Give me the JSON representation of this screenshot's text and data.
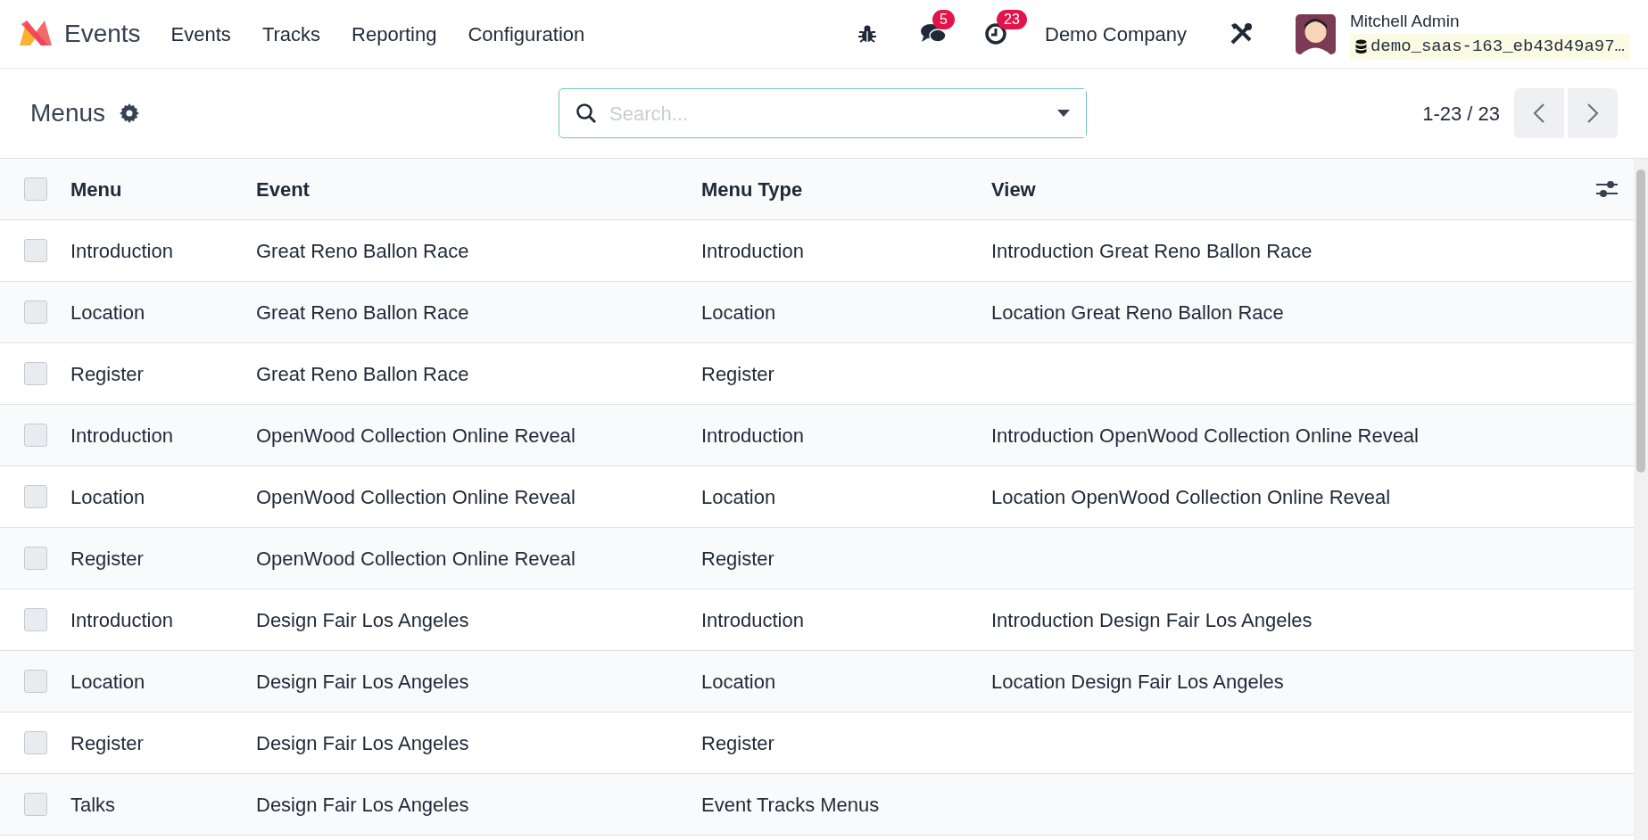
{
  "navbar": {
    "app_name": "Events",
    "menu": [
      "Events",
      "Tracks",
      "Reporting",
      "Configuration"
    ],
    "messages_badge": "5",
    "activities_badge": "23",
    "company": "Demo Company",
    "user": {
      "name": "Mitchell Admin",
      "database": "demo_saas-163_eb43d49a97…"
    }
  },
  "control_panel": {
    "title": "Menus",
    "search": {
      "placeholder": "Search..."
    },
    "pager": "1-23 / 23"
  },
  "table": {
    "columns": [
      "Menu",
      "Event",
      "Menu Type",
      "View"
    ],
    "all_checked": false,
    "rows": [
      {
        "checked": false,
        "cells": [
          "Introduction",
          "Great Reno Ballon Race",
          "Introduction",
          "Introduction Great Reno Ballon Race"
        ]
      },
      {
        "checked": false,
        "cells": [
          "Location",
          "Great Reno Ballon Race",
          "Location",
          "Location Great Reno Ballon Race"
        ]
      },
      {
        "checked": false,
        "cells": [
          "Register",
          "Great Reno Ballon Race",
          "Register",
          ""
        ]
      },
      {
        "checked": false,
        "cells": [
          "Introduction",
          "OpenWood Collection Online Reveal",
          "Introduction",
          "Introduction OpenWood Collection Online Reveal"
        ]
      },
      {
        "checked": false,
        "cells": [
          "Location",
          "OpenWood Collection Online Reveal",
          "Location",
          "Location OpenWood Collection Online Reveal"
        ]
      },
      {
        "checked": false,
        "cells": [
          "Register",
          "OpenWood Collection Online Reveal",
          "Register",
          ""
        ]
      },
      {
        "checked": false,
        "cells": [
          "Introduction",
          "Design Fair Los Angeles",
          "Introduction",
          "Introduction Design Fair Los Angeles"
        ]
      },
      {
        "checked": false,
        "cells": [
          "Location",
          "Design Fair Los Angeles",
          "Location",
          "Location Design Fair Los Angeles"
        ]
      },
      {
        "checked": false,
        "cells": [
          "Register",
          "Design Fair Los Angeles",
          "Register",
          ""
        ]
      },
      {
        "checked": false,
        "cells": [
          "Talks",
          "Design Fair Los Angeles",
          "Event Tracks Menus",
          ""
        ]
      }
    ]
  }
}
